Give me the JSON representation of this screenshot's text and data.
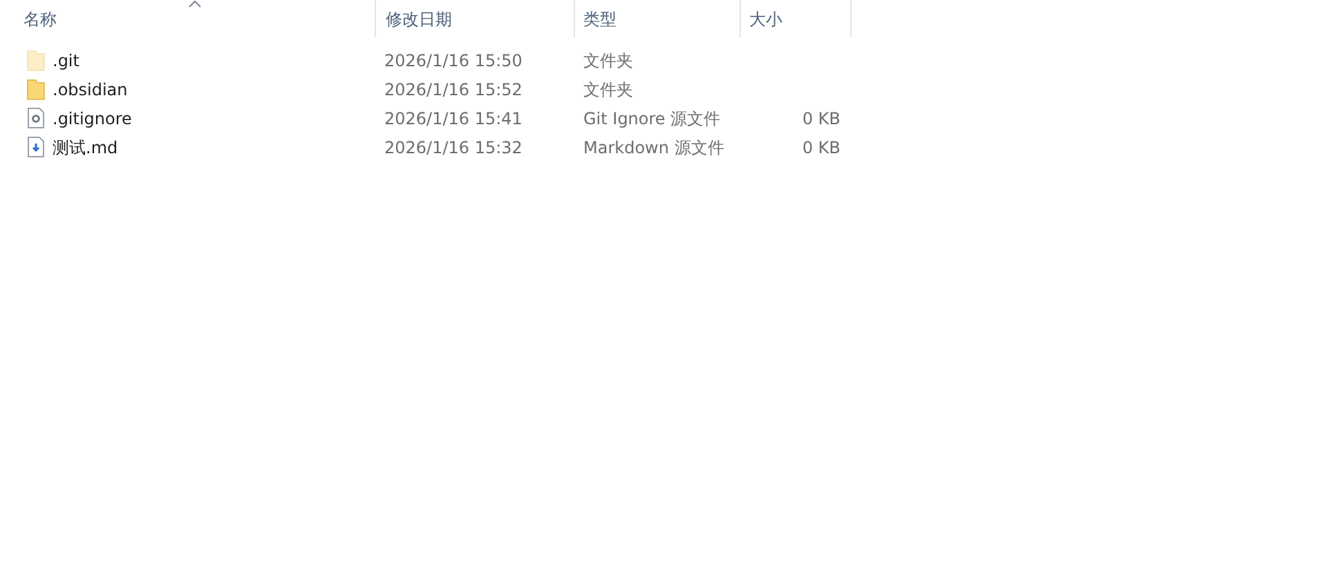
{
  "columns": [
    {
      "label": "名称",
      "sorted": true
    },
    {
      "label": "修改日期",
      "sorted": false
    },
    {
      "label": "类型",
      "sorted": false
    },
    {
      "label": "大小",
      "sorted": false
    }
  ],
  "rows": [
    {
      "kind": "folder",
      "hidden": true,
      "name": ".git",
      "modified": "2026/1/16 15:50",
      "type": "文件夹"
    },
    {
      "kind": "folder",
      "hidden": false,
      "name": ".obsidian",
      "modified": "2026/1/16 15:52",
      "type": "文件夹"
    },
    {
      "kind": "settings-file",
      "hidden": false,
      "name": ".gitignore",
      "modified": "2026/1/16 15:41",
      "type": "Git Ignore 源文件",
      "size": "0 KB"
    },
    {
      "kind": "text-file",
      "hidden": false,
      "name": "测试.md",
      "modified": "2026/1/16 15:32",
      "type": "Markdown 源文件",
      "size": "0 KB"
    }
  ]
}
